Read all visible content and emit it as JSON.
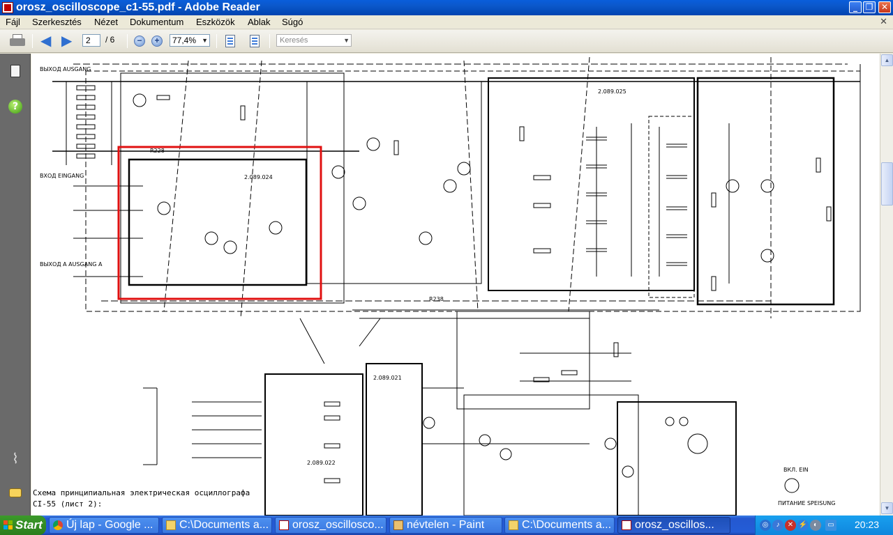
{
  "window": {
    "title": "orosz_oscilloscope_c1-55.pdf - Adobe Reader",
    "controls": {
      "minimize": "_",
      "maximize": "❐",
      "close": "✕"
    }
  },
  "menu": {
    "items": [
      "Fájl",
      "Szerkesztés",
      "Nézet",
      "Dokumentum",
      "Eszközök",
      "Ablak",
      "Súgó"
    ],
    "close_glyph": "✕"
  },
  "toolbar": {
    "page_current": "2",
    "page_total": "/ 6",
    "zoom_value": "77,4%",
    "search_placeholder": "Keresés",
    "icons": [
      "printer-icon",
      "arrow-left-icon",
      "arrow-right-icon",
      "zoom-out-icon",
      "zoom-in-icon",
      "fit-page-icon",
      "fit-width-icon"
    ]
  },
  "navpane": {
    "icons": [
      "pages-icon",
      "help-icon",
      "paperclip-icon",
      "comments-icon"
    ]
  },
  "document": {
    "caption_line1": "Схема принципиальная электрическая осциллографа",
    "caption_line2": "CI-55 (лист 2):",
    "highlight_color": "#e01010",
    "labels": {
      "vykhod": "ВЫХОД AUSGANG",
      "vkhod": "ВХОД EINGANG",
      "vykhod_a": "ВЫХОД А AUSGANG A",
      "board1": "2.089.024",
      "board2": "2.089.025",
      "board3": "2.089.021",
      "board4": "2.089.022",
      "r228": "R228",
      "r238": "R238",
      "vkl": "ВКЛ. EIN",
      "pitanie": "ПИТАНИЕ SPEISUNG"
    }
  },
  "taskbar": {
    "start_label": "Start",
    "tasks": [
      {
        "label": "Új lap - Google ...",
        "icon": "chrome-icon",
        "active": false
      },
      {
        "label": "C:\\Documents a...",
        "icon": "folder-icon",
        "active": false
      },
      {
        "label": "orosz_oscillosco...",
        "icon": "pdf-icon",
        "active": false
      },
      {
        "label": "névtelen - Paint",
        "icon": "paint-icon",
        "active": false
      },
      {
        "label": "C:\\Documents a...",
        "icon": "folder-icon",
        "active": false
      },
      {
        "label": "orosz_oscillos...",
        "icon": "pdf-icon",
        "active": true
      }
    ],
    "clock": "20:23"
  }
}
